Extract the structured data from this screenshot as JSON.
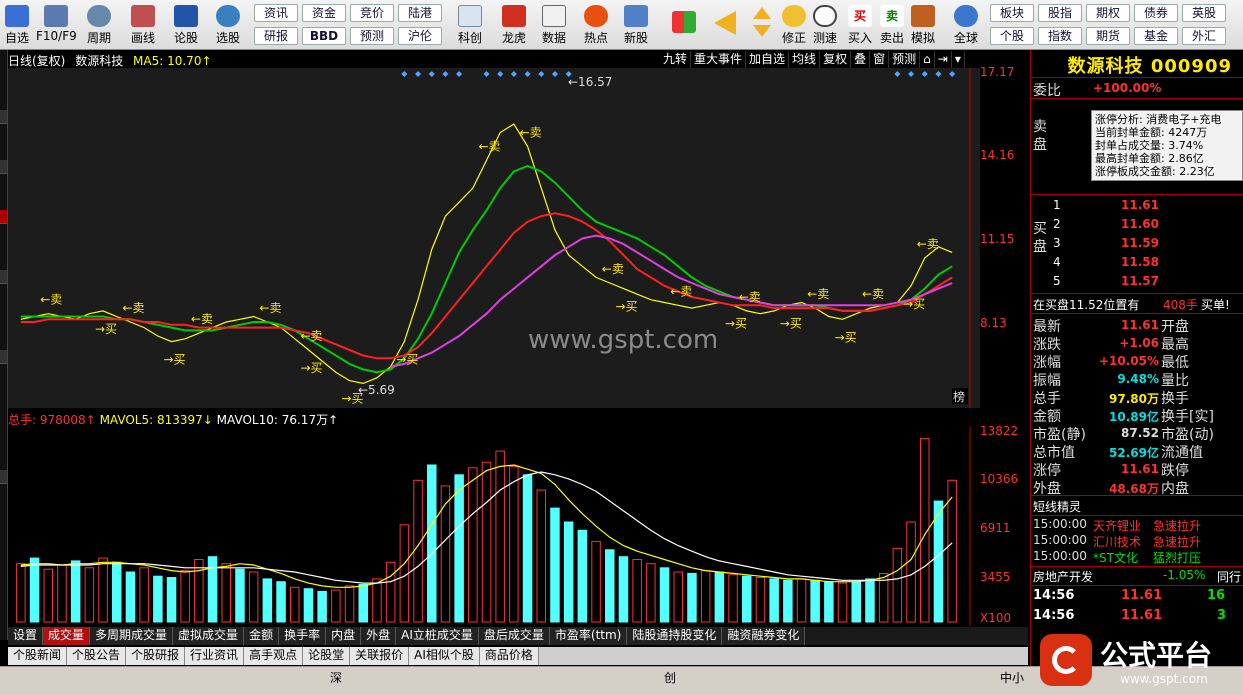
{
  "toolbar": {
    "buttons": [
      {
        "label": "自选",
        "icon": "star-icon"
      },
      {
        "label": "F10/F9",
        "icon": "f10-icon"
      },
      {
        "label": "周期",
        "icon": "clock-icon"
      },
      {
        "label": "画线",
        "icon": "pencil-icon"
      },
      {
        "label": "论股",
        "icon": "discuss-icon"
      },
      {
        "label": "选股",
        "icon": "select-stock-icon"
      }
    ],
    "grid_top": [
      "资讯",
      "资金",
      "竞价",
      "陆港"
    ],
    "grid_bottom": [
      "研报",
      "BBD",
      "预测",
      "沪伦"
    ],
    "mid_buttons": [
      {
        "label": "科创",
        "icon": "kechuang-icon"
      },
      {
        "label": "龙虎",
        "icon": "dragon-tiger-icon"
      },
      {
        "label": "数据",
        "icon": "pe-data-icon"
      },
      {
        "label": "热点",
        "icon": "hot-icon"
      },
      {
        "label": "新股",
        "icon": "ipo-icon"
      }
    ],
    "right_buttons": [
      {
        "label": "",
        "icon": "color-grid-icon"
      },
      {
        "label": "",
        "icon": "back-arrow-icon"
      },
      {
        "label": "修正",
        "icon": "fix-icon"
      },
      {
        "label": "测速",
        "icon": "speed-test-icon"
      },
      {
        "label": "买入",
        "icon": "buy-icon"
      },
      {
        "label": "卖出",
        "icon": "sell-icon"
      },
      {
        "label": "模拟",
        "icon": "simulate-icon"
      },
      {
        "label": "全球",
        "icon": "globe-icon"
      }
    ],
    "grid2_top": [
      "板块",
      "股指",
      "期权",
      "债券",
      "英股"
    ],
    "grid2_bottom": [
      "个股",
      "指数",
      "期货",
      "基金",
      "外汇"
    ]
  },
  "chart_header": {
    "period": "日线(复权)",
    "name": "数源科技",
    "ma5": "MA5: 10.70↑",
    "buttons": [
      "九转",
      "重大事件",
      "加自选",
      "均线",
      "复权",
      "叠",
      "窗",
      "预测"
    ]
  },
  "price_axis": [
    "17.17",
    "14.16",
    "11.15",
    "8.13"
  ],
  "annotations": {
    "high": "←16.57",
    "low": "←5.69",
    "watermark": "www.gspt.com",
    "buy": "买",
    "sell": "卖",
    "bang": "榜"
  },
  "volume_header": {
    "total": "总手: 978008↑",
    "mavol5": "MAVOL5: 813397↓",
    "mavol10": "MAVOL10: 76.17万↑"
  },
  "volume_axis": [
    "13822",
    "10366",
    "6911",
    "3455",
    "X100"
  ],
  "chart_data": [
    {
      "type": "line",
      "title": "日线(复权) 数源科技",
      "ylim": [
        5.69,
        17.17
      ],
      "series": [
        {
          "name": "MA5",
          "color": "#ffff00",
          "values": [
            8.3,
            8.4,
            8.5,
            8.4,
            8.3,
            8.5,
            8.6,
            8.4,
            8.2,
            8.0,
            7.7,
            7.5,
            7.6,
            7.8,
            8.0,
            8.2,
            8.3,
            8.4,
            8.2,
            8.0,
            7.6,
            7.2,
            6.8,
            6.4,
            6.1,
            6.0,
            6.2,
            6.6,
            7.5,
            9.0,
            10.8,
            12.0,
            12.5,
            13.0,
            14.0,
            15.0,
            15.3,
            14.5,
            13.0,
            11.5,
            10.6,
            10.2,
            9.8,
            9.6,
            9.4,
            9.2,
            9.0,
            8.9,
            8.8,
            8.7,
            8.8,
            8.9,
            8.8,
            8.6,
            8.5,
            8.6,
            8.8,
            8.9,
            8.7,
            8.4,
            8.3,
            8.5,
            8.7,
            8.8,
            8.9,
            9.5,
            10.5,
            10.9,
            10.7
          ]
        },
        {
          "name": "MA10",
          "color": "#00cc00",
          "values": [
            8.4,
            8.4,
            8.4,
            8.4,
            8.4,
            8.4,
            8.4,
            8.3,
            8.3,
            8.2,
            8.1,
            8.0,
            7.9,
            7.9,
            7.9,
            8.0,
            8.1,
            8.2,
            8.2,
            8.1,
            7.9,
            7.6,
            7.3,
            7.0,
            6.7,
            6.5,
            6.4,
            6.5,
            6.9,
            7.6,
            8.5,
            9.6,
            10.7,
            11.5,
            12.2,
            13.0,
            13.6,
            13.8,
            13.6,
            13.2,
            12.7,
            12.2,
            11.8,
            11.6,
            11.4,
            11.2,
            10.9,
            10.6,
            10.2,
            9.8,
            9.5,
            9.3,
            9.1,
            9.0,
            8.9,
            8.8,
            8.8,
            8.8,
            8.8,
            8.7,
            8.6,
            8.6,
            8.6,
            8.7,
            8.8,
            9.0,
            9.4,
            9.9,
            10.2
          ]
        },
        {
          "name": "MA20",
          "color": "#ff2020",
          "values": [
            8.2,
            8.2,
            8.3,
            8.3,
            8.3,
            8.3,
            8.3,
            8.3,
            8.3,
            8.2,
            8.2,
            8.1,
            8.1,
            8.0,
            8.0,
            8.0,
            8.0,
            8.0,
            8.0,
            8.0,
            7.9,
            7.8,
            7.6,
            7.4,
            7.2,
            7.0,
            6.9,
            6.9,
            7.0,
            7.3,
            7.8,
            8.4,
            9.0,
            9.6,
            10.2,
            10.8,
            11.4,
            11.8,
            12.0,
            12.1,
            12.0,
            11.8,
            11.5,
            11.1,
            10.6,
            10.1,
            9.8,
            9.5,
            9.3,
            9.1,
            9.0,
            8.9,
            8.8,
            8.8,
            8.8,
            8.7,
            8.7,
            8.7,
            8.7,
            8.7,
            8.6,
            8.6,
            8.6,
            8.7,
            8.8,
            8.9,
            9.2,
            9.5,
            9.8
          ]
        },
        {
          "name": "MA60",
          "color": "#e040e0",
          "values": [
            null,
            null,
            null,
            null,
            null,
            null,
            null,
            null,
            null,
            null,
            null,
            null,
            null,
            null,
            null,
            null,
            null,
            null,
            null,
            null,
            null,
            null,
            null,
            null,
            null,
            null,
            null,
            6.6,
            6.7,
            6.9,
            7.1,
            7.4,
            7.7,
            8.1,
            8.5,
            9.0,
            9.4,
            9.8,
            10.2,
            10.6,
            10.9,
            11.2,
            11.3,
            11.2,
            11.0,
            10.7,
            10.4,
            10.1,
            9.8,
            9.6,
            9.4,
            9.2,
            9.1,
            9.0,
            8.9,
            8.8,
            8.8,
            8.8,
            8.8,
            8.8,
            8.8,
            8.8,
            8.8,
            8.8,
            8.9,
            9.0,
            9.2,
            9.4,
            9.6
          ]
        }
      ],
      "annotations": {
        "high": 16.57,
        "low": 5.69
      },
      "buy_indices": [
        6,
        11,
        21,
        24,
        28,
        44,
        52,
        56,
        60,
        65
      ],
      "sell_indices": [
        2,
        8,
        13,
        18,
        21,
        34,
        37,
        43,
        48,
        53,
        58,
        62,
        66
      ]
    },
    {
      "type": "bar",
      "title": "总手",
      "ylim": [
        0,
        13822
      ],
      "values": [
        4200,
        4600,
        3800,
        4100,
        4400,
        3900,
        4600,
        4300,
        3600,
        3900,
        3300,
        3200,
        3700,
        4500,
        4700,
        4200,
        3800,
        3600,
        3100,
        2900,
        2500,
        2400,
        2200,
        2300,
        2600,
        2700,
        3100,
        4300,
        7000,
        10200,
        11300,
        9800,
        10600,
        11100,
        11500,
        12300,
        11200,
        10600,
        9500,
        8200,
        7200,
        6600,
        5800,
        5200,
        4700,
        4500,
        4200,
        3900,
        3600,
        3500,
        3700,
        3600,
        3400,
        3300,
        3200,
        3100,
        3000,
        3100,
        3000,
        2900,
        2800,
        2900,
        3100,
        3500,
        5300,
        7200,
        13200,
        8700,
        10200
      ],
      "colors": [
        "r",
        "c",
        "r",
        "r",
        "c",
        "r",
        "r",
        "c",
        "c",
        "r",
        "c",
        "c",
        "r",
        "r",
        "c",
        "r",
        "c",
        "r",
        "c",
        "c",
        "r",
        "c",
        "c",
        "r",
        "r",
        "c",
        "r",
        "r",
        "r",
        "r",
        "c",
        "r",
        "c",
        "r",
        "r",
        "r",
        "r",
        "c",
        "r",
        "c",
        "c",
        "c",
        "r",
        "c",
        "c",
        "r",
        "r",
        "c",
        "r",
        "c",
        "r",
        "c",
        "r",
        "c",
        "r",
        "c",
        "c",
        "r",
        "c",
        "c",
        "r",
        "c",
        "c",
        "r",
        "r",
        "r",
        "r",
        "c",
        "r"
      ],
      "series": [
        {
          "name": "MAVOL5",
          "color": "#ffff00",
          "values": [
            4100,
            4200,
            4200,
            4100,
            4200,
            4200,
            4300,
            4300,
            4200,
            4100,
            3900,
            3700,
            3600,
            3700,
            3900,
            4000,
            4200,
            4100,
            3800,
            3500,
            3100,
            2800,
            2600,
            2500,
            2500,
            2600,
            2800,
            3300,
            4200,
            5500,
            7000,
            8500,
            9500,
            10200,
            10900,
            11200,
            11300,
            11000,
            10700,
            9900,
            8800,
            7800,
            6900,
            6100,
            5500,
            5100,
            4800,
            4500,
            4200,
            3900,
            3700,
            3600,
            3500,
            3400,
            3300,
            3200,
            3100,
            3100,
            3000,
            2900,
            2900,
            2900,
            3000,
            3200,
            3700,
            4500,
            6300,
            7800,
            9000
          ]
        },
        {
          "name": "MAVOL10",
          "color": "#ffffff",
          "values": [
            4000,
            4100,
            4100,
            4100,
            4100,
            4100,
            4200,
            4200,
            4200,
            4200,
            4100,
            4000,
            3900,
            3900,
            3900,
            3900,
            3900,
            3900,
            3800,
            3700,
            3600,
            3400,
            3200,
            3000,
            2900,
            2800,
            2800,
            2900,
            3300,
            4000,
            4900,
            5900,
            6900,
            7800,
            8600,
            9500,
            10100,
            10600,
            10800,
            10600,
            10300,
            9900,
            9400,
            8700,
            8000,
            7300,
            6600,
            6000,
            5500,
            5100,
            4700,
            4400,
            4200,
            4000,
            3800,
            3600,
            3400,
            3300,
            3200,
            3100,
            3000,
            3000,
            3000,
            3000,
            3100,
            3400,
            4000,
            4800,
            5700
          ]
        }
      ]
    }
  ],
  "indicator_tabs": [
    "设置",
    "成交量",
    "多周期成交量",
    "虚拟成交量",
    "金额",
    "换手率",
    "内盘",
    "外盘",
    "AI立桩成交量",
    "盘后成交量",
    "市盈率(ttm)",
    "陆股通持股变化",
    "融资融券变化"
  ],
  "news_tabs": [
    "个股新闻",
    "个股公告",
    "个股研报",
    "行业资讯",
    "高手观点",
    "论股堂",
    "关联报价",
    "AI相似个股",
    "商品价格"
  ],
  "status_bar": {
    "items": [
      "深",
      "创",
      "中小"
    ]
  },
  "right_panel": {
    "name": "数源科技",
    "code": "000909",
    "weibi_label": "委比",
    "weibi": "+100.00%",
    "sell_label": "卖盘",
    "buy_label": "买盘",
    "limit_info": [
      "涨停分析: 消费电子+充电",
      "当前封单金额: 4247万",
      "封单占成交量: 3.74%",
      "最高封单金额: 2.86亿",
      "涨停板成交金额: 2.23亿"
    ],
    "bids": [
      {
        "lv": "1",
        "price": "11.61"
      },
      {
        "lv": "2",
        "price": "11.60"
      },
      {
        "lv": "3",
        "price": "11.59"
      },
      {
        "lv": "4",
        "price": "11.58"
      },
      {
        "lv": "5",
        "price": "11.57"
      }
    ],
    "in_buy": "在买盘11.52位置有",
    "in_buy_qty": "408手",
    "in_buy_tail": "买单!",
    "quote": [
      {
        "k1": "最新",
        "v1": "11.61",
        "k2": "开盘",
        "c": ""
      },
      {
        "k1": "涨跌",
        "v1": "+1.06",
        "k2": "最高",
        "c": ""
      },
      {
        "k1": "涨幅",
        "v1": "+10.05%",
        "k2": "最低",
        "c": ""
      },
      {
        "k1": "振幅",
        "v1": "9.48%",
        "k2": "量比",
        "c": "c"
      },
      {
        "k1": "总手",
        "v1": "97.80万",
        "k2": "换手",
        "c": "y"
      },
      {
        "k1": "金额",
        "v1": "10.89亿",
        "k2": "换手[实]",
        "c": "c"
      },
      {
        "k1": "市盈(静)",
        "v1": "87.52",
        "k2": "市盈(动)",
        "c": "w"
      },
      {
        "k1": "总市值",
        "v1": "52.69亿",
        "k2": "流通值",
        "c": "c"
      },
      {
        "k1": "涨停",
        "v1": "11.61",
        "k2": "跌停",
        "c": ""
      },
      {
        "k1": "外盘",
        "v1": "48.68万",
        "k2": "内盘",
        "c": ""
      }
    ],
    "signal_title": "短线精灵",
    "signals": [
      {
        "t": "15:00:00",
        "n": "天齐锂业",
        "s": "急速拉升"
      },
      {
        "t": "15:00:00",
        "n": "汇川技术",
        "s": "急速拉升"
      },
      {
        "t": "15:00:00",
        "n": "*ST文化",
        "s": "猛烈打压"
      }
    ],
    "sector": "房地产开发",
    "sector_chg": "-1.05%",
    "sector_tail": "同行",
    "ticks": [
      {
        "t": "14:56",
        "p": "11.61",
        "q": "16"
      },
      {
        "t": "14:56",
        "p": "11.61",
        "q": "3"
      }
    ]
  },
  "logo": {
    "text": "公式平台",
    "url": "www.gspt.com"
  }
}
